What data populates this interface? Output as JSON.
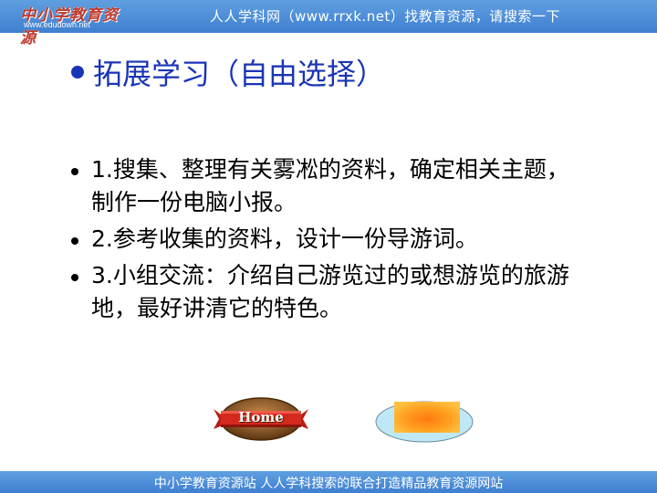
{
  "header": {
    "logo_text": "中小学教育资源",
    "logo_url": "www.edudown.net",
    "banner_text": "人人学科网（www.rrxk.net）找教育资源，请搜索一下"
  },
  "slide": {
    "title": "拓展学习（自由选择）",
    "items": [
      {
        "text": "1.搜集、整理有关雾凇的资料，确定相关主题，制作一份电脑小报。"
      },
      {
        "text": "2.参考收集的资料，设计一份导游词。"
      },
      {
        "text": "3.小组交流：介绍自己游览过的或想游览的旅游地，最好讲清它的特色。"
      }
    ]
  },
  "buttons": {
    "home_label": "Home"
  },
  "footer": {
    "text": "中小学教育资源站  人人学科搜索的联合打造精品教育资源网站"
  },
  "colors": {
    "banner": "#4a8ad8",
    "title": "#1a35b5",
    "home_wood": "#8b5a2b",
    "home_ribbon": "#d42a1e",
    "orange_fill": "#ffa020",
    "ellipse_fill": "#bfe8f7"
  }
}
